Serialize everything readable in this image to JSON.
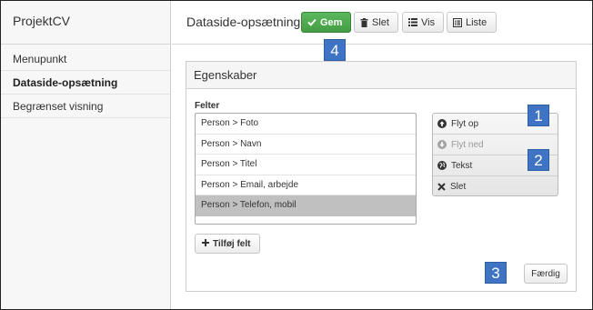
{
  "sidebar": {
    "brand": "ProjektCV",
    "items": [
      {
        "label": "Menupunkt"
      },
      {
        "label": "Dataside-opsætning"
      },
      {
        "label": "Begrænset visning"
      }
    ]
  },
  "header": {
    "title": "Dataside-opsætning",
    "buttons": {
      "save": "Gem",
      "delete": "Slet",
      "view": "Vis",
      "list": "Liste"
    }
  },
  "panel": {
    "title": "Egenskaber",
    "fields_label": "Felter",
    "fields": [
      {
        "label": "Person > Foto"
      },
      {
        "label": "Person > Navn"
      },
      {
        "label": "Person > Titel"
      },
      {
        "label": "Person > Email, arbejde"
      },
      {
        "label": "Person > Telefon, mobil"
      }
    ],
    "selected_field_index": 4,
    "add_field": "Tilføj felt",
    "actions": [
      {
        "label": "Flyt op",
        "icon": "arrow-up-circle-icon"
      },
      {
        "label": "Flyt ned",
        "icon": "arrow-down-circle-icon",
        "disabled": true
      },
      {
        "label": "Tekst",
        "icon": "globe-icon"
      },
      {
        "label": "Slet",
        "icon": "x-icon"
      }
    ],
    "done": "Færdig"
  },
  "callouts": [
    "1",
    "2",
    "3",
    "4"
  ],
  "colors": {
    "save_button": "#449d44",
    "selected_row": "#c0c0c0",
    "callout": "#3f74c4"
  }
}
